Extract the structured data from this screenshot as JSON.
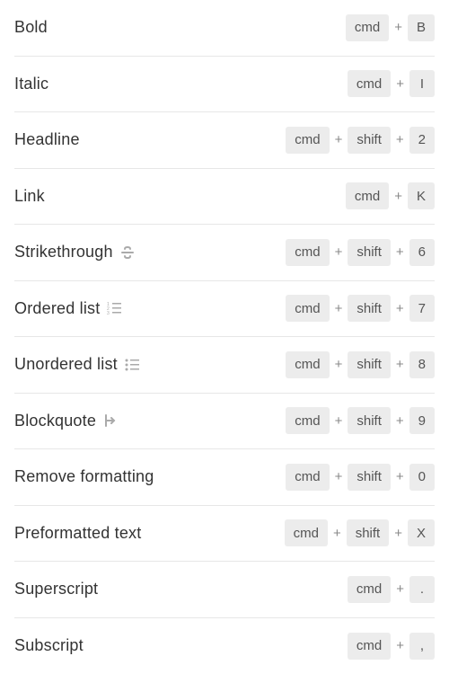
{
  "shortcuts": [
    {
      "label": "Bold",
      "icon": null,
      "keys": [
        "cmd",
        "B"
      ]
    },
    {
      "label": "Italic",
      "icon": null,
      "keys": [
        "cmd",
        "I"
      ]
    },
    {
      "label": "Headline",
      "icon": null,
      "keys": [
        "cmd",
        "shift",
        "2"
      ]
    },
    {
      "label": "Link",
      "icon": null,
      "keys": [
        "cmd",
        "K"
      ]
    },
    {
      "label": "Strikethrough",
      "icon": "strikethrough",
      "keys": [
        "cmd",
        "shift",
        "6"
      ]
    },
    {
      "label": "Ordered list",
      "icon": "ordered-list",
      "keys": [
        "cmd",
        "shift",
        "7"
      ]
    },
    {
      "label": "Unordered list",
      "icon": "unordered-list",
      "keys": [
        "cmd",
        "shift",
        "8"
      ]
    },
    {
      "label": "Blockquote",
      "icon": "blockquote",
      "keys": [
        "cmd",
        "shift",
        "9"
      ]
    },
    {
      "label": "Remove formatting",
      "icon": null,
      "keys": [
        "cmd",
        "shift",
        "0"
      ]
    },
    {
      "label": "Preformatted text",
      "icon": null,
      "keys": [
        "cmd",
        "shift",
        "X"
      ]
    },
    {
      "label": "Superscript",
      "icon": null,
      "keys": [
        "cmd",
        "."
      ]
    },
    {
      "label": "Subscript",
      "icon": null,
      "keys": [
        "cmd",
        ","
      ]
    }
  ],
  "plus": "+"
}
